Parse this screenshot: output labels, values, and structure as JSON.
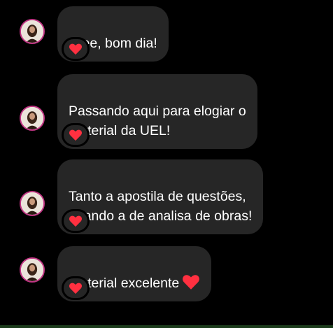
{
  "colors": {
    "background": "#000000",
    "bubble": "#262626",
    "text": "#ffffff",
    "heart": "#ff3040",
    "avatar_ring": "#c13584"
  },
  "messages": [
    {
      "text": "Oiee, bom dia!",
      "reaction": "red-heart"
    },
    {
      "text": "Passando aqui para elogiar o\nmaterial da UEL!",
      "reaction": "red-heart"
    },
    {
      "text": "Tanto a apostila de questões,\nquando a de analisa de obras!",
      "reaction": "red-heart"
    },
    {
      "text": "Material excelente",
      "emoji": "red-heart",
      "reaction": "red-heart"
    }
  ]
}
